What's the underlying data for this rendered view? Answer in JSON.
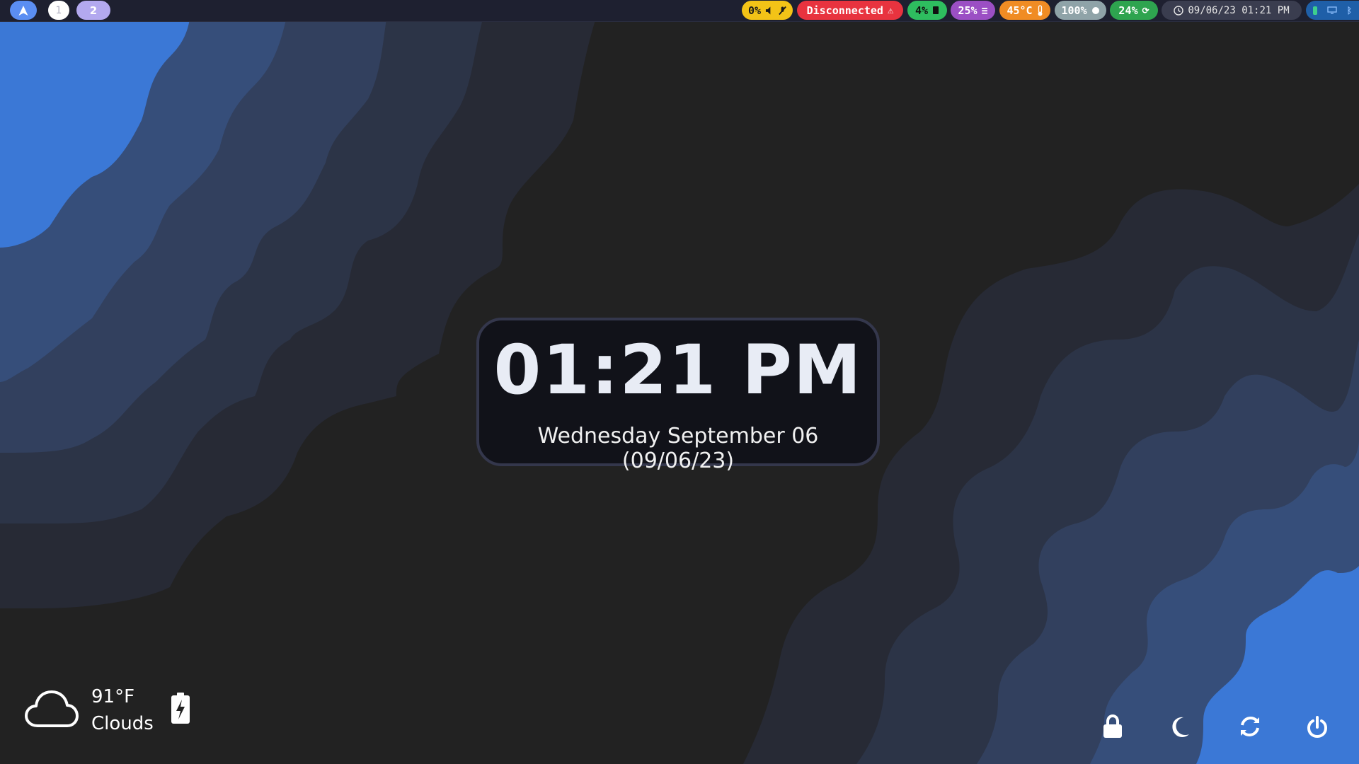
{
  "topbar": {
    "launcher": {
      "icon": "arch-logo-icon",
      "color": "#5b8ef2"
    },
    "workspaces": [
      {
        "label": "1",
        "color": "#ffffff",
        "text_color": "#c8c8d8"
      },
      {
        "label": "2",
        "color": "#b3a9ef",
        "text_color": "#ffffff"
      }
    ],
    "modules": [
      {
        "name": "volume",
        "label": "0%",
        "icons": [
          "speaker-icon",
          "mic-muted-icon"
        ],
        "color": "#f3c317",
        "text_color": "#1a1a1a"
      },
      {
        "name": "network",
        "label": "Disconnected",
        "icons": [
          "warning-icon"
        ],
        "color": "#e8333f",
        "text_color": "#ffffff"
      },
      {
        "name": "cpu",
        "label": "4%",
        "icons": [
          "cpu-icon"
        ],
        "color": "#2ebd5f",
        "text_color": "#111111"
      },
      {
        "name": "memory",
        "label": "25%",
        "icons": [
          "memory-icon"
        ],
        "color": "#9b4fc4",
        "text_color": "#ffffff"
      },
      {
        "name": "temperature",
        "label": "45°C",
        "icons": [
          "thermometer-icon"
        ],
        "color": "#f08c24",
        "text_color": "#ffffff"
      },
      {
        "name": "brightness",
        "label": "100%",
        "icons": [
          "brightness-icon"
        ],
        "color": "#8fa3a8",
        "text_color": "#ffffff"
      },
      {
        "name": "battery",
        "label": "24%",
        "icons": [
          "charging-icon"
        ],
        "color": "#2ea44f",
        "text_color": "#ffffff"
      },
      {
        "name": "clock",
        "label": "09/06/23 01:21 PM",
        "icons": [
          "clock-icon"
        ],
        "color": "#3a3d4f",
        "text_color": "#e6e6e6"
      },
      {
        "name": "tray",
        "label": "",
        "icons": [
          "tray-app-icon",
          "display-icon",
          "bluetooth-icon"
        ],
        "color": "#1f5fa8",
        "text_color": "#ffffff"
      }
    ]
  },
  "clock": {
    "time": "01:21 PM",
    "date": "Wednesday September 06 (09/06/23)"
  },
  "weather": {
    "icon": "cloud-icon",
    "temperature": "91°F",
    "condition": "Clouds",
    "battery_icon": "battery-charging-icon"
  },
  "power_menu": [
    {
      "name": "lock-button",
      "icon": "lock-icon"
    },
    {
      "name": "suspend-button",
      "icon": "moon-icon"
    },
    {
      "name": "reboot-button",
      "icon": "refresh-icon"
    },
    {
      "name": "shutdown-button",
      "icon": "power-icon"
    }
  ],
  "colors": {
    "wallpaper_base": "#222222",
    "wave_1": "#272a35",
    "wave_2": "#2c3447",
    "wave_3": "#32405e",
    "wave_4": "#364e7a",
    "wave_5": "#3b78d6"
  }
}
